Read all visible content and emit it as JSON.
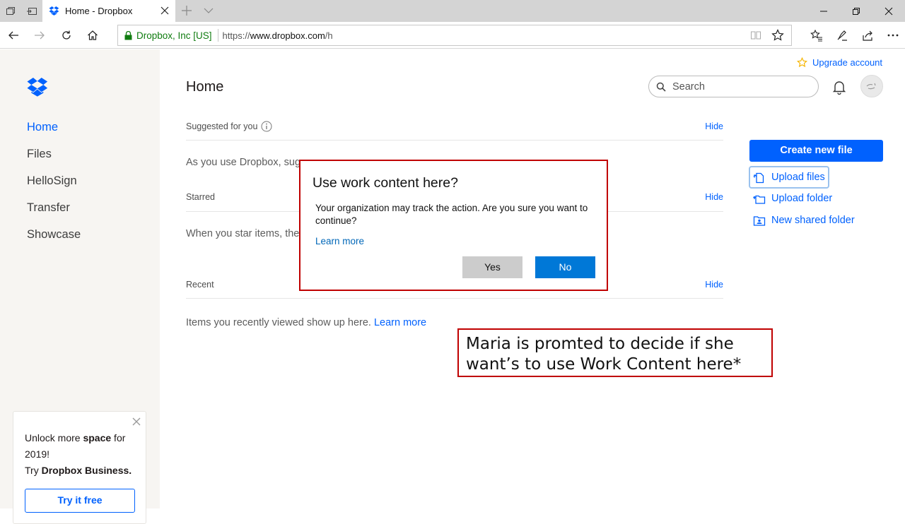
{
  "browser": {
    "tab_title": "Home - Dropbox",
    "identity": "Dropbox, Inc [US]",
    "url_prefix": "https://",
    "url_domain": "www.dropbox.com",
    "url_path": "/h"
  },
  "sidebar": {
    "items": [
      {
        "label": "Home",
        "active": true
      },
      {
        "label": "Files"
      },
      {
        "label": "HelloSign"
      },
      {
        "label": "Transfer"
      },
      {
        "label": "Showcase"
      }
    ],
    "promo": {
      "line1_pre": "Unlock more ",
      "line1_bold": "space",
      "line1_post": " for 2019!",
      "line2_pre": "Try ",
      "line2_bold": "Dropbox Business.",
      "button": "Try it free"
    }
  },
  "header": {
    "upgrade": "Upgrade account",
    "title": "Home",
    "search_placeholder": "Search"
  },
  "sections": {
    "suggested": {
      "label": "Suggested for you",
      "hide": "Hide",
      "body": "As you use Dropbox, sugg"
    },
    "starred": {
      "label": "Starred",
      "hide": "Hide",
      "body": "When you star items, they"
    },
    "recent": {
      "label": "Recent",
      "hide": "Hide",
      "body": "Items you recently viewed show up here. ",
      "link": "Learn more"
    }
  },
  "actions": {
    "create": "Create new file",
    "upload_files": "Upload files",
    "upload_folder": "Upload folder",
    "new_shared_folder": "New shared folder"
  },
  "dialog": {
    "title": "Use work content here?",
    "message": "Your organization may track the action. Are you sure you want to continue?",
    "link": "Learn more",
    "yes": "Yes",
    "no": "No"
  },
  "callout": {
    "text": "Maria is promted to decide if she want’s to use Work Content here*"
  },
  "colors": {
    "accent": "#0061fe",
    "sidebar_bg": "#f7f5f2",
    "annotation_border": "#c00000",
    "dialog_primary": "#0078d7"
  }
}
